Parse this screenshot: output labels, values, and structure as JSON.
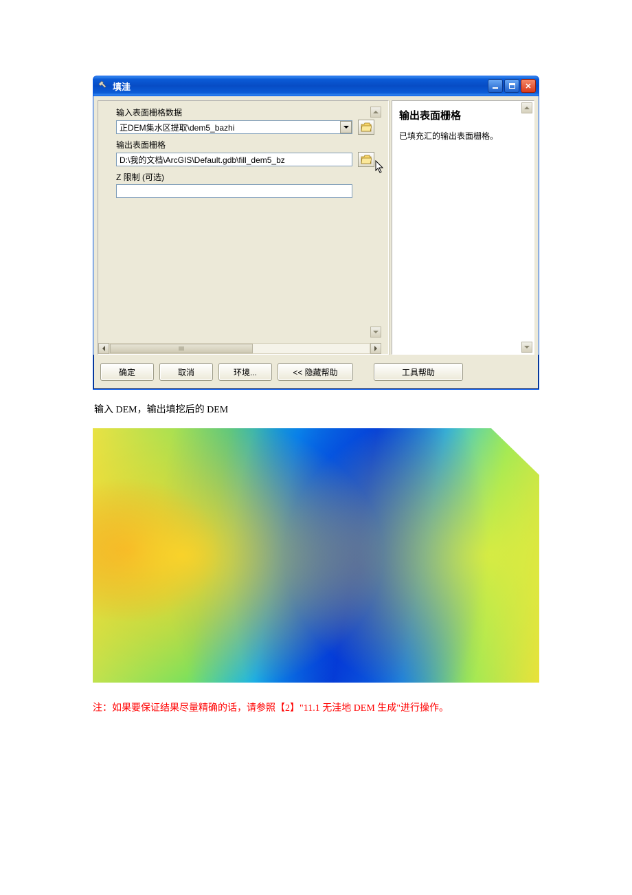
{
  "window": {
    "title": "填洼",
    "buttons": {
      "ok": "确定",
      "cancel": "取消",
      "env": "环境...",
      "hide_help": "<< 隐藏帮助",
      "tool_help": "工具帮助"
    }
  },
  "form": {
    "input_label": "输入表面栅格数据",
    "input_value": "正DEM集水区提取\\dem5_bazhi",
    "output_label": "输出表面栅格",
    "output_value": "D:\\我的文档\\ArcGIS\\Default.gdb\\fill_dem5_bz",
    "zlimit_label": "Z 限制 (可选)",
    "zlimit_value": ""
  },
  "help": {
    "title": "输出表面栅格",
    "body": "已填充汇的输出表面栅格。"
  },
  "caption1": "输入 DEM，输出填挖后的 DEM",
  "note": "注：如果要保证结果尽量精确的话，请参照【2】\"11.1 无洼地 DEM 生成\"进行操作。"
}
